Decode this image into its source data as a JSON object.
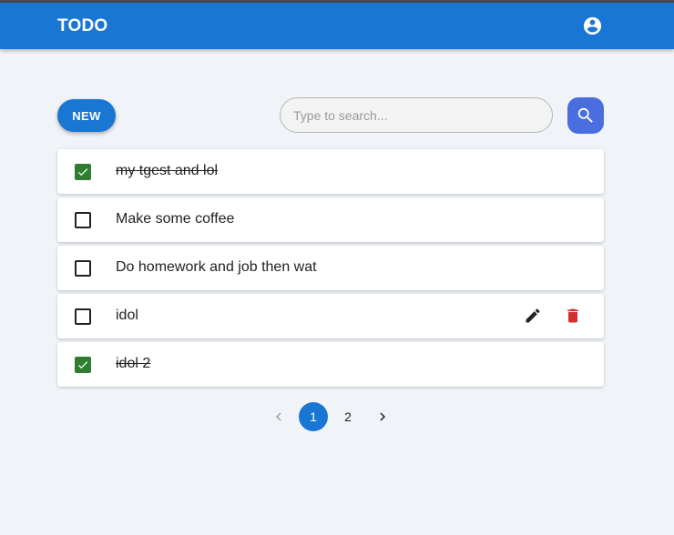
{
  "app": {
    "title": "TODO",
    "brand_color": "#1976d2",
    "account_icon": "account-circle-icon"
  },
  "toolbar": {
    "new_label": "NEW",
    "search_placeholder": "Type to search...",
    "search_value": "",
    "search_icon": "search-icon"
  },
  "todos": [
    {
      "text": "my tgest and lol",
      "completed": true
    },
    {
      "text": "Make some coffee",
      "completed": false
    },
    {
      "text": "Do homework and job then wat",
      "completed": false
    },
    {
      "text": "idol",
      "completed": false,
      "hovered": true
    },
    {
      "text": "idol 2",
      "completed": true
    }
  ],
  "item_actions": {
    "edit_icon": "pencil-icon",
    "delete_icon": "trash-icon",
    "delete_color": "#d32f2f"
  },
  "pagination": {
    "current_page": "1",
    "pages": [
      "1",
      "2"
    ],
    "prev_icon": "chevron-left-icon",
    "next_icon": "chevron-right-icon"
  },
  "colors": {
    "checked": "#2e7d32",
    "search_button": "#4a6ee0",
    "background": "#f0f4f8"
  }
}
